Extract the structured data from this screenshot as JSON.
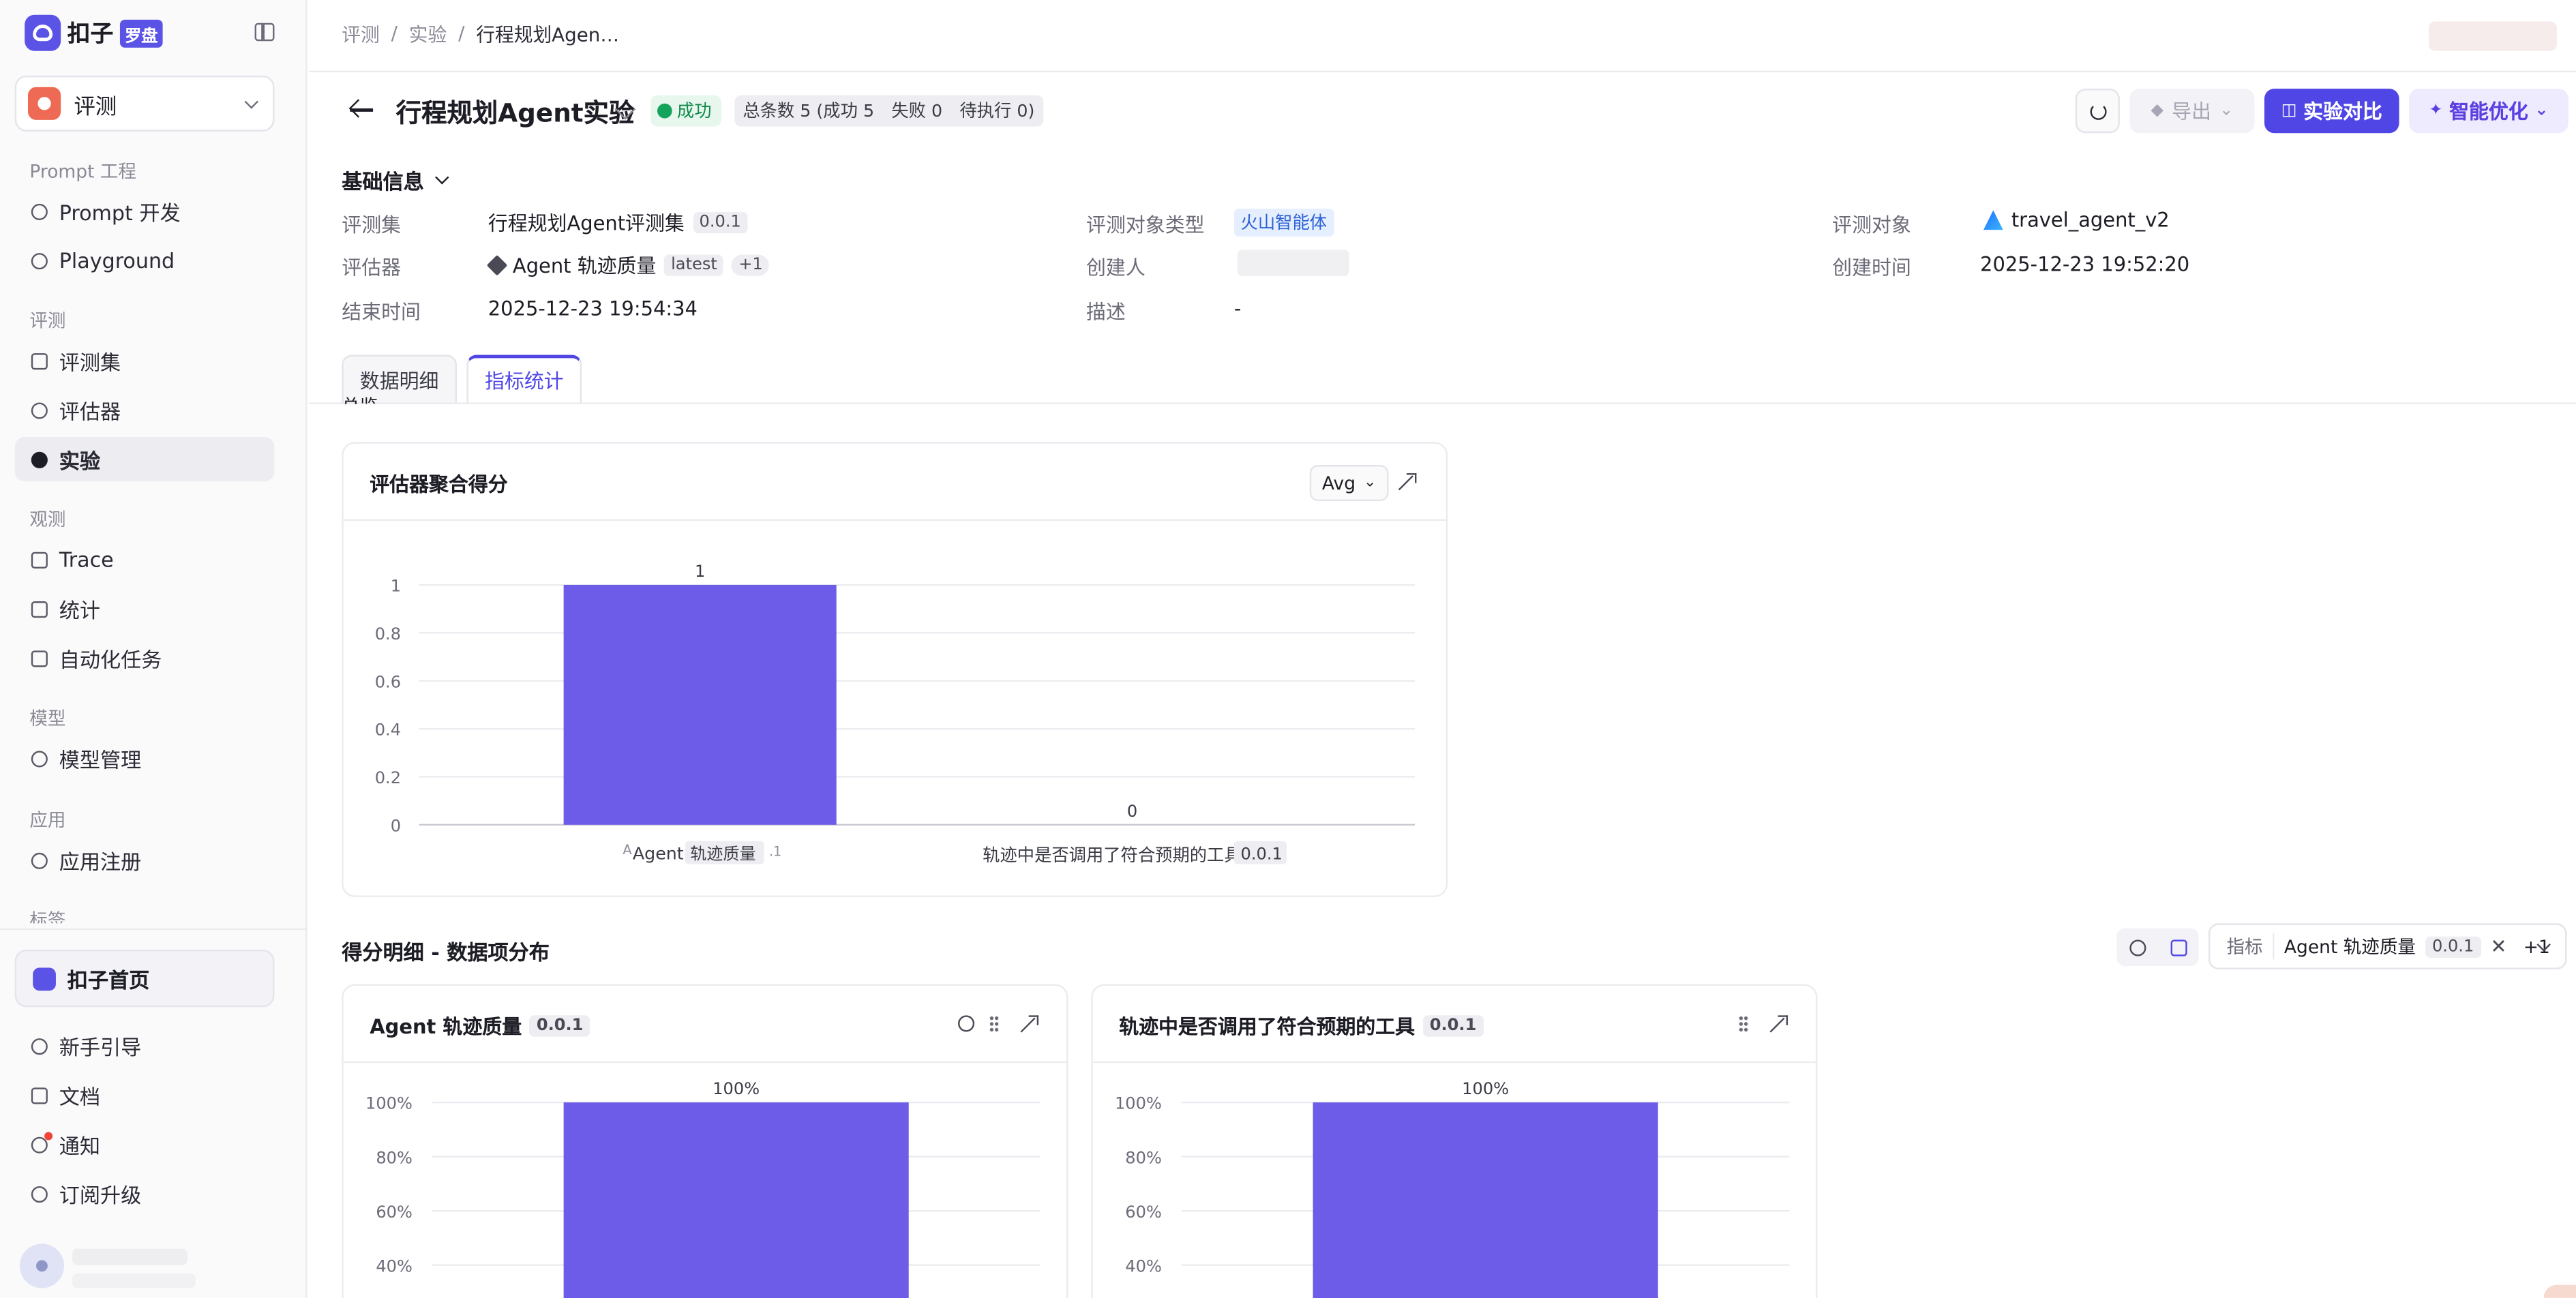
{
  "app": {
    "logo_text": "扣子",
    "logo_badge": "罗盘"
  },
  "sidebar": {
    "space": "评测",
    "groups": {
      "prompt": "Prompt 工程",
      "eval": "评测",
      "observe": "观测",
      "model": "模型",
      "app": "应用",
      "tag": "标签"
    },
    "items": {
      "prompt_dev": "Prompt 开发",
      "playground": "Playground",
      "eval_set": "评测集",
      "evaluator": "评估器",
      "experiment": "实验",
      "trace": "Trace",
      "stats": "统计",
      "auto_task": "自动化任务",
      "model_mgmt": "模型管理",
      "app_register": "应用注册"
    },
    "home": "扣子首页",
    "bottom": {
      "guide": "新手引导",
      "docs": "文档",
      "notify": "通知",
      "upgrade": "订阅升级"
    }
  },
  "breadcrumb": {
    "c1": "评测",
    "c2": "实验",
    "c3": "行程规划Agen…",
    "sep": "/"
  },
  "header": {
    "title": "行程规划Agent实验",
    "status": "成功",
    "counts": "总条数 5 (成功 5　失败 0　待执行 0)",
    "export": "导出",
    "compare": "实验对比",
    "optimize": "智能优化"
  },
  "basic_info": {
    "section": "基础信息",
    "eval_set_label": "评测集",
    "eval_set_value": "行程规划Agent评测集",
    "eval_set_version": "0.0.1",
    "target_type_label": "评测对象类型",
    "target_type_value": "火山智能体",
    "target_label": "评测对象",
    "target_value": "travel_agent_v2",
    "evaluator_label": "评估器",
    "evaluator_value": "Agent 轨迹质量",
    "evaluator_version": "latest",
    "evaluator_more": "+1",
    "creator_label": "创建人",
    "created_label": "创建时间",
    "created_value": "2025-12-23 19:52:20",
    "ended_label": "结束时间",
    "ended_value": "2025-12-23 19:54:34",
    "desc_label": "描述",
    "desc_value": "-"
  },
  "tabs": {
    "detail": "数据明细",
    "metrics": "指标统计"
  },
  "overview_cut": "总览",
  "agg_card": {
    "title": "评估器聚合得分",
    "agg": "Avg"
  },
  "dist_section": {
    "title": "得分明细 - 数据项分布",
    "filter_label": "指标",
    "filter_value": "Agent 轨迹质量",
    "filter_version": "0.0.1",
    "filter_more": "+1",
    "filter_clear": "✕"
  },
  "dist_cards": [
    {
      "title": "Agent 轨迹质量",
      "version": "0.0.1"
    },
    {
      "title": "轨迹中是否调用了符合预期的工具",
      "version": "0.0.1"
    }
  ],
  "chart_data": [
    {
      "type": "bar",
      "title": "评估器聚合得分",
      "categories": [
        "Agent 轨迹质量 0.0.1",
        "轨迹中是否调用了符合预期的工具 0.0.1"
      ],
      "category_labels": [
        {
          "name": "Agent",
          "tag": "轨迹质量",
          "suffix": ".1",
          "prefix": "A"
        },
        {
          "name": "轨迹中是否调用了符合预期的工具",
          "tag": "0.0.1"
        }
      ],
      "values": [
        1,
        0
      ],
      "data_labels": [
        "1",
        "0"
      ],
      "ylim": [
        0,
        1
      ],
      "yticks": [
        "0",
        "0.2",
        "0.4",
        "0.6",
        "0.8",
        "1"
      ],
      "grid": true,
      "color": "#6c5ce7"
    },
    {
      "type": "bar",
      "title": "Agent 轨迹质量",
      "values": [
        100
      ],
      "data_labels": [
        "100%"
      ],
      "ylim": [
        0,
        100
      ],
      "yticks": [
        "40%",
        "60%",
        "80%",
        "100%"
      ],
      "grid": true,
      "color": "#6c5ce7"
    },
    {
      "type": "bar",
      "title": "轨迹中是否调用了符合预期的工具",
      "values": [
        100
      ],
      "data_labels": [
        "100%"
      ],
      "ylim": [
        0,
        100
      ],
      "yticks": [
        "40%",
        "60%",
        "80%",
        "100%"
      ],
      "grid": true,
      "color": "#6c5ce7"
    }
  ]
}
